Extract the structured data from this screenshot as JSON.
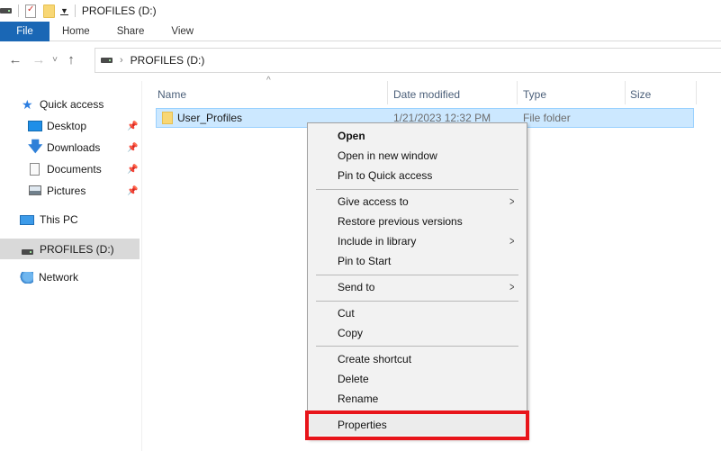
{
  "window": {
    "title": "PROFILES (D:)",
    "quick_access_toolbar": [
      "drive-icon",
      "properties-icon",
      "new-folder-icon",
      "customize-dropdown-icon"
    ]
  },
  "ribbon": {
    "tabs": [
      {
        "label": "File",
        "active": true
      },
      {
        "label": "Home"
      },
      {
        "label": "Share"
      },
      {
        "label": "View"
      }
    ],
    "file_tab_color": "#1a67b5"
  },
  "navigation": {
    "back": "←",
    "forward": "→",
    "recent": "˅",
    "up": "↑",
    "breadcrumb": [
      "PROFILES (D:)"
    ]
  },
  "sidebar": {
    "items": [
      {
        "label": "Quick access",
        "icon": "star-icon"
      },
      {
        "label": "Desktop",
        "icon": "desktop-icon",
        "pinned": true
      },
      {
        "label": "Downloads",
        "icon": "download-icon",
        "pinned": true
      },
      {
        "label": "Documents",
        "icon": "documents-icon",
        "pinned": true
      },
      {
        "label": "Pictures",
        "icon": "pictures-icon",
        "pinned": true
      },
      {
        "label": "This PC",
        "icon": "computer-icon"
      },
      {
        "label": "PROFILES (D:)",
        "icon": "drive-icon",
        "selected": true
      },
      {
        "label": "Network",
        "icon": "network-icon"
      }
    ],
    "pin_glyph": "📌"
  },
  "file_list": {
    "sort_indicator": "^",
    "columns": [
      "Name",
      "Date modified",
      "Type",
      "Size"
    ],
    "rows": [
      {
        "name": "User_Profiles",
        "date_modified": "1/21/2023 12:32 PM",
        "type": "File folder",
        "size": "",
        "selected": true
      }
    ]
  },
  "context_menu": {
    "groups": [
      [
        {
          "label": "Open",
          "bold": true
        },
        {
          "label": "Open in new window"
        },
        {
          "label": "Pin to Quick access"
        }
      ],
      [
        {
          "label": "Give access to",
          "submenu": true
        },
        {
          "label": "Restore previous versions"
        },
        {
          "label": "Include in library",
          "submenu": true
        },
        {
          "label": "Pin to Start"
        }
      ],
      [
        {
          "label": "Send to",
          "submenu": true
        }
      ],
      [
        {
          "label": "Cut"
        },
        {
          "label": "Copy"
        }
      ],
      [
        {
          "label": "Create shortcut"
        },
        {
          "label": "Delete"
        },
        {
          "label": "Rename"
        }
      ],
      [
        {
          "label": "Properties",
          "highlighted": true
        }
      ]
    ],
    "submenu_glyph": ">",
    "highlight_color": "#e8141a"
  }
}
